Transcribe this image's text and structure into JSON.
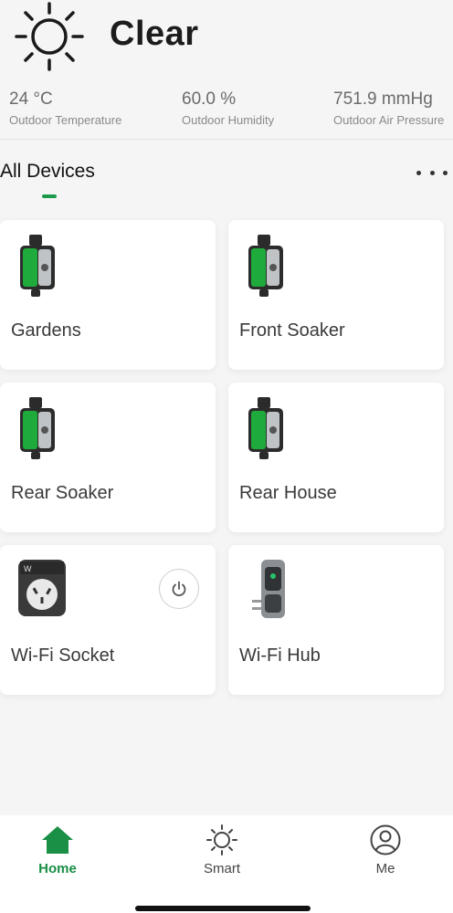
{
  "weather": {
    "condition": "Clear",
    "icon": "sun-icon",
    "stats": [
      {
        "value": "24 °C",
        "label": "Outdoor Temperature"
      },
      {
        "value": "60.0 %",
        "label": "Outdoor Humidity"
      },
      {
        "value": "751.9 mmHg",
        "label": "Outdoor Air Pressure"
      }
    ]
  },
  "section": {
    "title": "All Devices",
    "accent_color": "#1a9a4a"
  },
  "devices": [
    {
      "name": "Gardens",
      "icon": "tap-timer-icon"
    },
    {
      "name": "Front Soaker",
      "icon": "tap-timer-icon"
    },
    {
      "name": "Rear Soaker",
      "icon": "tap-timer-icon"
    },
    {
      "name": "Rear House",
      "icon": "tap-timer-icon"
    },
    {
      "name": "Wi-Fi Socket",
      "icon": "smart-plug-icon"
    },
    {
      "name": "Wi-Fi Hub",
      "icon": "hub-icon"
    }
  ],
  "nav": {
    "items": [
      {
        "label": "Home",
        "icon": "home-icon",
        "active": true
      },
      {
        "label": "Smart",
        "icon": "sun-icon",
        "active": false
      },
      {
        "label": "Me",
        "icon": "profile-icon",
        "active": false
      }
    ],
    "active_color": "#1a8f46"
  }
}
